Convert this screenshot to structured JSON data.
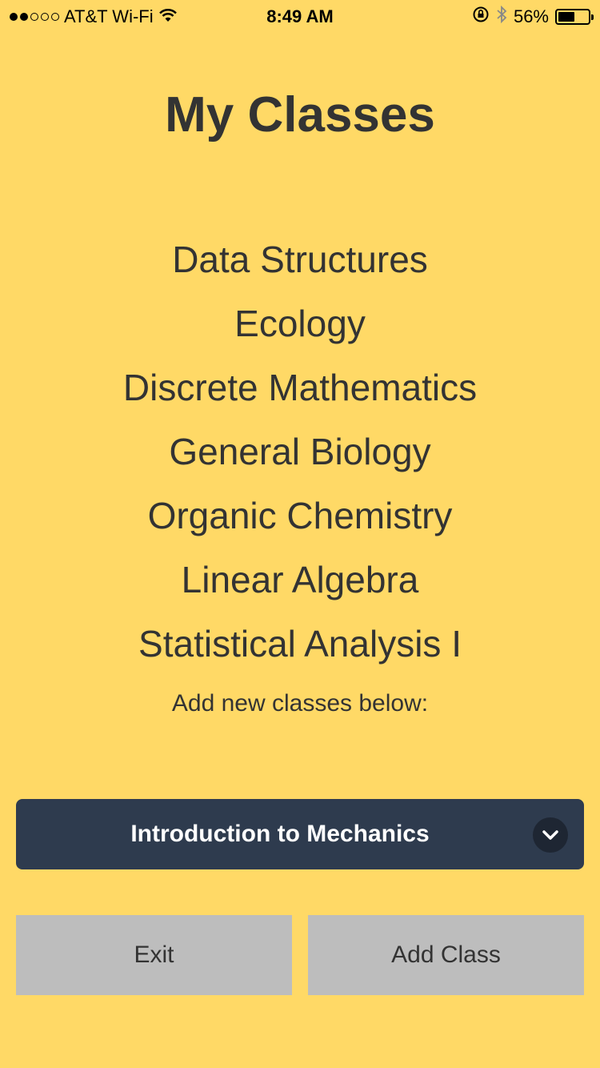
{
  "status_bar": {
    "carrier": "AT&T Wi-Fi",
    "time": "8:49 AM",
    "battery": "56%",
    "battery_level": 0.56,
    "signal_bars_filled": 2,
    "signal_bars_total": 5,
    "icons": [
      "wifi-icon",
      "rotation-lock-icon",
      "bluetooth-icon",
      "battery-icon"
    ]
  },
  "page": {
    "title": "My Classes",
    "classes": [
      "Data Structures",
      "Ecology",
      "Discrete Mathematics",
      "General Biology",
      "Organic Chemistry",
      "Linear Algebra",
      "Statistical Analysis I"
    ],
    "add_hint": "Add new classes below:"
  },
  "class_select": {
    "selected": "Introduction to Mechanics",
    "icon": "chevron-down-icon"
  },
  "buttons": {
    "exit_label": "Exit",
    "add_label": "Add Class"
  },
  "colors": {
    "background": "#FFD966",
    "select_bg": "#2E3B4E",
    "button_bg": "#BDBDBD",
    "text": "#333333"
  }
}
